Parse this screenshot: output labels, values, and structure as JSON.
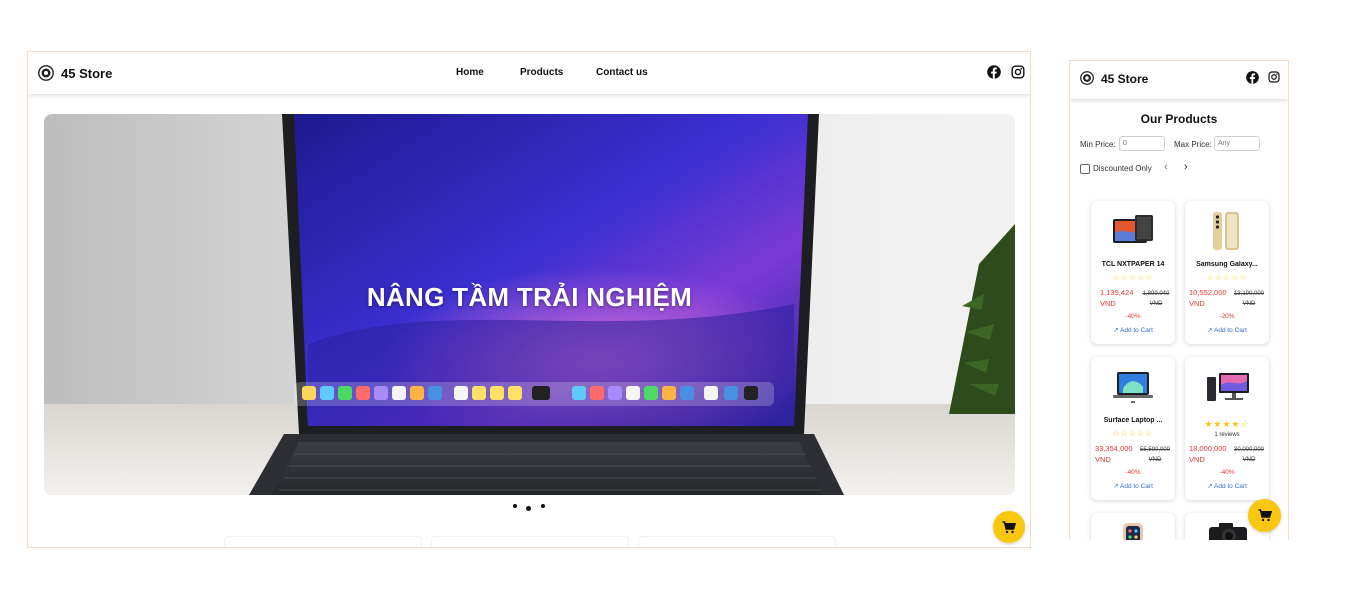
{
  "desktop": {
    "logo_text": "45 Store",
    "nav": [
      "Home",
      "Products",
      "Contact us"
    ],
    "hero_title": "NÂNG TẦM TRẢI NGHIỆM",
    "carousel_dots": 3,
    "carousel_active": 1
  },
  "mobile": {
    "logo_text": "45 Store",
    "section_title": "Our Products",
    "filters": {
      "min_label": "Min Price:",
      "min_value": "0",
      "max_label": "Max Price:",
      "max_placeholder": "Any",
      "discount_label": "Discounted Only"
    },
    "products": [
      {
        "name": "TCL NXTPAPER 14",
        "stars": "☆☆☆☆☆",
        "reviews": "",
        "price": "1,139,424",
        "currency": "VND",
        "old_price": "1,899,040",
        "old_currency": "VND",
        "discount": "-40%",
        "add_label": "Add to Cart",
        "image": "tablet"
      },
      {
        "name": "Samsung Galaxy...",
        "stars": "☆☆☆☆☆",
        "reviews": "",
        "price": "10,552,000",
        "currency": "VND",
        "old_price": "13,190,000",
        "old_currency": "VND",
        "discount": "-20%",
        "add_label": "Add to Cart",
        "image": "phone"
      },
      {
        "name": "Surface Laptop ...",
        "stars": "☆☆☆☆☆",
        "reviews": "",
        "price": "33,354,000",
        "currency": "VND",
        "old_price": "55,590,000",
        "old_currency": "VND",
        "discount": "-40%",
        "add_label": "Add to Cart",
        "image": "laptop"
      },
      {
        "name": "",
        "stars": "★★★★☆",
        "reviews": "1 reviews",
        "price": "18,000,000",
        "currency": "VND",
        "old_price": "30,000,000",
        "old_currency": "VND",
        "discount": "-40%",
        "add_label": "Add to Cart",
        "image": "desktop-pc"
      }
    ]
  },
  "colors": {
    "accent": "#f9c80e",
    "price": "#e53935",
    "link": "#2f6fd8",
    "border": "#f6dcc4"
  },
  "icons": [
    "store-logo-icon",
    "facebook-icon",
    "instagram-icon",
    "cart-icon",
    "chevron-left-icon",
    "chevron-right-icon",
    "arrow-up-right-icon"
  ]
}
